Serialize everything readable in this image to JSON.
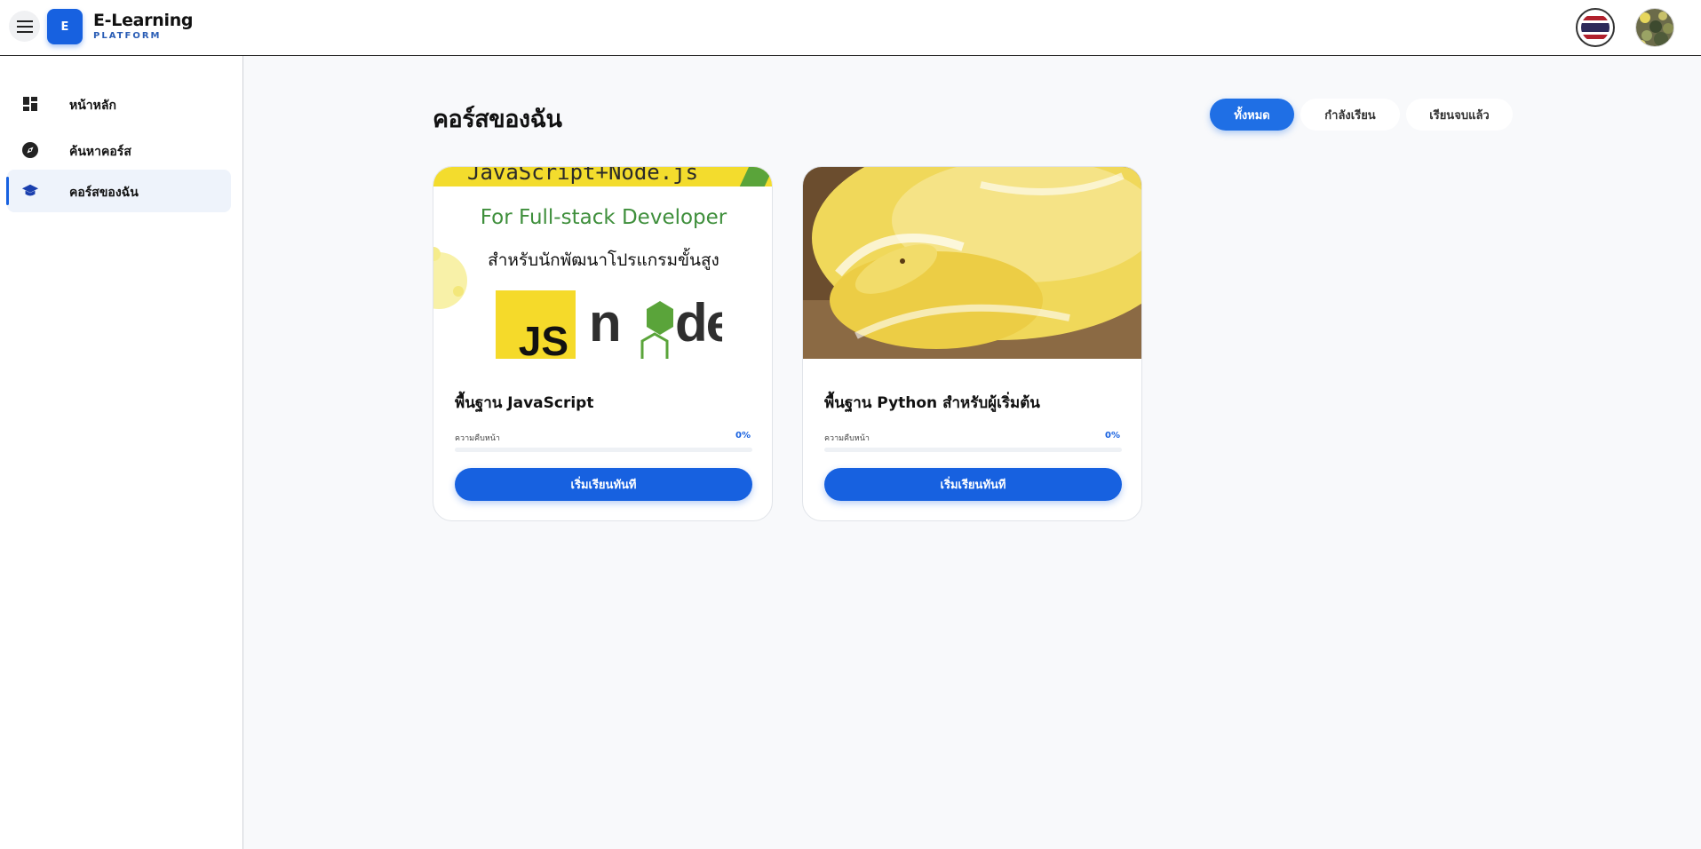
{
  "header": {
    "logo_letter": "E",
    "brand_name": "E-Learning",
    "brand_sub": "PLATFORM"
  },
  "icons": {
    "menu": "hamburger-menu-icon",
    "flag": "thai-flag-icon",
    "avatar": "user-avatar",
    "dashboard": "dashboard-icon",
    "explore": "compass-icon",
    "my_courses": "school-cap-icon"
  },
  "sidebar": {
    "items": [
      {
        "label": "หน้าหลัก",
        "active": false
      },
      {
        "label": "ค้นหาคอร์ส",
        "active": false
      },
      {
        "label": "คอร์สของฉัน",
        "active": true
      }
    ]
  },
  "main": {
    "title": "คอร์สของฉัน",
    "tabs": [
      {
        "label": "ทั้งหมด",
        "active": true
      },
      {
        "label": "กำลังเรียน",
        "active": false
      },
      {
        "label": "เรียนจบแล้ว",
        "active": false
      }
    ]
  },
  "courses": [
    {
      "title": "พื้นฐาน JavaScript",
      "progress_label": "ความคืบหน้า",
      "progress_value": "0%",
      "progress": 0,
      "button_label": "เริ่มเรียนทันที",
      "thumb": {
        "banner_text": "JavaScript+Node.js",
        "subtitle_en": "For Full-stack Developer",
        "subtitle_th": "สำหรับนักพัฒนาโปรแกรมขั้นสูง",
        "js_logo": "JS",
        "node_logo": "node"
      }
    },
    {
      "title": "พื้นฐาน Python สำหรับผู้เริ่มต้น",
      "progress_label": "ความคืบหน้า",
      "progress_value": "0%",
      "progress": 0,
      "button_label": "เริ่มเรียนทันที",
      "thumb": {
        "image": "yellow-albino-python-photo"
      }
    }
  ],
  "colors": {
    "primary": "#1761e0",
    "background": "#f8f9fb",
    "js_yellow": "#f3dc2d",
    "node_green": "#3f8f3c",
    "python_yellow": "#f2e07a"
  }
}
